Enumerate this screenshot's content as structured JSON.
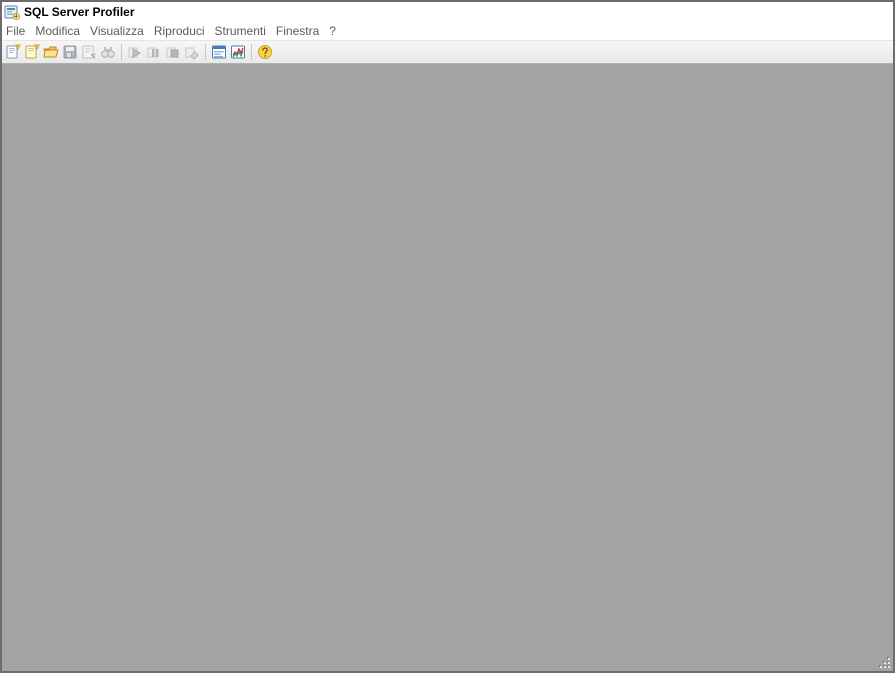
{
  "window": {
    "title": "SQL Server Profiler"
  },
  "menu": {
    "file": "File",
    "edit": "Modifica",
    "view": "Visualizza",
    "replay": "Riproduci",
    "tools": "Strumenti",
    "window": "Finestra",
    "help": "?"
  },
  "toolbar": {
    "new_trace": "new-trace",
    "new_template": "new-template",
    "open": "open-file",
    "save": "save",
    "properties": "properties",
    "find": "find",
    "start": "start-trace",
    "pause": "pause-trace",
    "stop": "stop-trace",
    "clear": "clear-trace-window",
    "tuning_advisor": "database-tuning-advisor",
    "activity_monitor": "activity-monitor",
    "help": "help"
  }
}
